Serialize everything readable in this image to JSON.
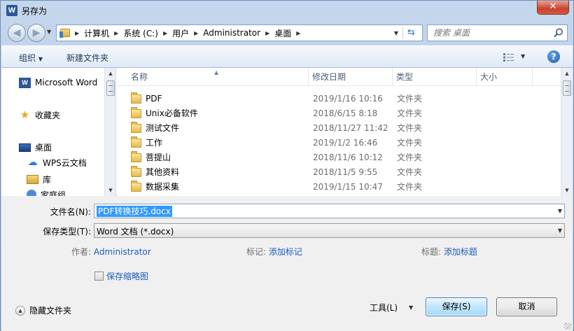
{
  "window": {
    "title": "另存为",
    "app_icon": "W",
    "close_label": "✕"
  },
  "address": {
    "crumbs": [
      "计算机",
      "系统 (C:)",
      "用户",
      "Administrator",
      "桌面"
    ],
    "search_placeholder": "搜索 桌面"
  },
  "toolbar": {
    "organize_label": "组织",
    "new_folder_label": "新建文件夹",
    "help_label": "?"
  },
  "navpane": {
    "items": [
      {
        "label": "Microsoft Word",
        "icon": "word-icon"
      },
      {
        "label": "收藏夹",
        "icon": "star-icon"
      },
      {
        "label": "桌面",
        "icon": "desktop-icon"
      },
      {
        "label": "WPS云文档",
        "icon": "cloud-icon"
      },
      {
        "label": "库",
        "icon": "library-icon"
      },
      {
        "label": "家庭组",
        "icon": "homegroup-icon"
      }
    ]
  },
  "columns": {
    "name": "名称",
    "date": "修改日期",
    "type": "类型",
    "size": "大小"
  },
  "files": [
    {
      "name": "PDF",
      "date": "2019/1/16 10:16",
      "type": "文件夹"
    },
    {
      "name": "Unix必备软件",
      "date": "2018/6/15 8:18",
      "type": "文件夹"
    },
    {
      "name": "测试文件",
      "date": "2018/11/27 11:42",
      "type": "文件夹"
    },
    {
      "name": "工作",
      "date": "2019/1/2 16:46",
      "type": "文件夹"
    },
    {
      "name": "菩提山",
      "date": "2018/11/6 10:12",
      "type": "文件夹"
    },
    {
      "name": "其他资料",
      "date": "2018/11/5 9:55",
      "type": "文件夹"
    },
    {
      "name": "数据采集",
      "date": "2019/1/15 10:47",
      "type": "文件夹"
    }
  ],
  "form": {
    "filename_label": "文件名(N):",
    "filename_value": "PDF转换技巧.docx",
    "filetype_label": "保存类型(T):",
    "filetype_value": "Word 文档 (*.docx)",
    "author_label": "作者:",
    "author_value": "Administrator",
    "tags_label": "标记:",
    "tags_value": "添加标记",
    "title_label": "标题:",
    "title_value": "添加标题",
    "thumbnail_label": "保存缩略图",
    "hide_folders_label": "隐藏文件夹",
    "tools_label": "工具(L)",
    "save_label": "保存(S)",
    "cancel_label": "取消"
  }
}
